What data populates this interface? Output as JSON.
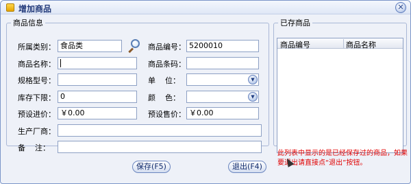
{
  "window": {
    "title": "增加商品",
    "close_symbol": "✕"
  },
  "goods_info": {
    "legend": "商品信息",
    "fields": {
      "category": {
        "label": "所属类别：",
        "value": "食品类"
      },
      "code": {
        "label": "商品编号：",
        "value": "5200010"
      },
      "name": {
        "label": "商品名称：",
        "value": ""
      },
      "barcode": {
        "label": "商品条码：",
        "value": ""
      },
      "spec": {
        "label": "规格型号：",
        "value": ""
      },
      "unit": {
        "label": "单    位：",
        "value": ""
      },
      "min_stock": {
        "label": "库存下限：",
        "value": "0"
      },
      "color": {
        "label": "颜    色：",
        "value": ""
      },
      "purchase_price": {
        "label": "预设进价：",
        "value": "￥0.00"
      },
      "sale_price": {
        "label": "预设售价：",
        "value": "￥0.00"
      },
      "manufacturer": {
        "label": "生产厂商：",
        "value": ""
      },
      "remark": {
        "label": "备    注：",
        "value": ""
      }
    }
  },
  "saved_goods": {
    "legend": "已存商品",
    "columns": [
      "商品编号",
      "商品名称"
    ],
    "rows": []
  },
  "buttons": {
    "save": "保存(F5)",
    "exit": "退出(F4)"
  },
  "hint": "此列表中显示的是已经保存过的商品，如果要退出请直接点“退出”按钮。",
  "icons": {
    "search": "search-icon",
    "dropdown": "chevron-down-icon"
  },
  "colors": {
    "hint": "#e00000",
    "title": "#223a7a",
    "border": "#7b95c8"
  }
}
